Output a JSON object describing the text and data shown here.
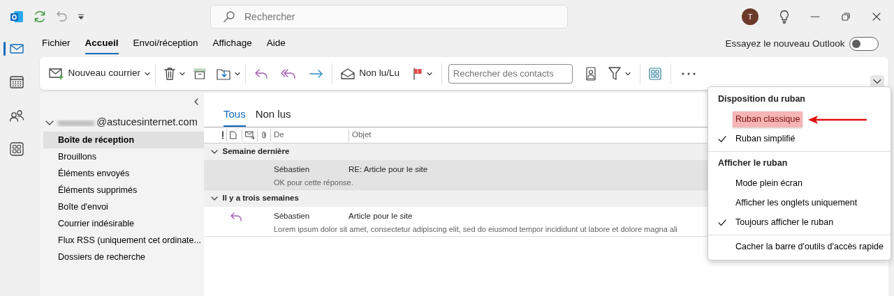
{
  "title_bar": {
    "search": {
      "placeholder": "Rechercher"
    },
    "avatar": "T"
  },
  "rail": [
    {
      "kind": "mail",
      "selected": true
    },
    {
      "kind": "calendar",
      "selected": false
    },
    {
      "kind": "people",
      "selected": false
    },
    {
      "kind": "apps",
      "selected": false
    }
  ],
  "ribbon_tabs": [
    {
      "label": "Fichier",
      "selected": false
    },
    {
      "label": "Accueil",
      "selected": true
    },
    {
      "label": "Envoi/réception",
      "selected": false
    },
    {
      "label": "Affichage",
      "selected": false
    },
    {
      "label": "Aide",
      "selected": false
    }
  ],
  "new_outlook": {
    "label": "Essayez le nouveau Outlook",
    "on": false
  },
  "ribbon": {
    "new_mail": "Nouveau courrier",
    "read_unread": "Non lu/Lu",
    "contact_search": {
      "placeholder": "Rechercher des contacts"
    }
  },
  "folders": {
    "account": "@astucesinternet.com",
    "expanded": true,
    "items": [
      {
        "label": "Boîte de réception",
        "selected": true
      },
      {
        "label": "Brouillons",
        "selected": false
      },
      {
        "label": "Éléments envoyés",
        "selected": false
      },
      {
        "label": "Éléments supprimés",
        "selected": false
      },
      {
        "label": "Boîte d'envoi",
        "selected": false
      },
      {
        "label": "Courrier indésirable",
        "selected": false
      },
      {
        "label": "Flux RSS (uniquement cet ordinate...",
        "selected": false
      },
      {
        "label": "Dossiers de recherche",
        "selected": false
      }
    ]
  },
  "message_list": {
    "filters": [
      {
        "label": "Tous",
        "selected": true
      },
      {
        "label": "Non lus",
        "selected": false
      }
    ],
    "columns": [
      "De",
      "Objet"
    ],
    "groups": [
      {
        "label": "Semaine dernière",
        "expanded": true,
        "messages": [
          {
            "from": "Sébastien",
            "subject": "RE: Article pour le site",
            "preview": "OK pour cette réponse.",
            "selected": true,
            "replied": false
          }
        ]
      },
      {
        "label": "Il y a trois semaines",
        "expanded": true,
        "messages": [
          {
            "from": "Sébastien",
            "subject": "Article pour le site",
            "preview": "Lorem ipsum dolor sit amet, consectetur adipiscing elit, sed do eiusmod tempor incididunt ut labore et dolore magna ali",
            "selected": false,
            "replied": true
          }
        ]
      }
    ]
  },
  "ribbon_menu": {
    "sections": [
      {
        "title": "Disposition du ruban",
        "items": [
          {
            "label": "Ruban classique",
            "checked": false,
            "highlighted": true
          },
          {
            "label": "Ruban simplifié",
            "checked": true,
            "highlighted": false
          }
        ]
      },
      {
        "title": "Afficher le ruban",
        "items": [
          {
            "label": "Mode plein écran",
            "checked": false,
            "highlighted": false
          },
          {
            "label": "Afficher les onglets uniquement",
            "checked": false,
            "highlighted": false
          },
          {
            "label": "Toujours afficher le ruban",
            "checked": true,
            "highlighted": false
          }
        ]
      },
      {
        "items": [
          {
            "label": "Cacher la barre d'outils d'accès rapide",
            "checked": false,
            "highlighted": false
          }
        ]
      }
    ]
  }
}
